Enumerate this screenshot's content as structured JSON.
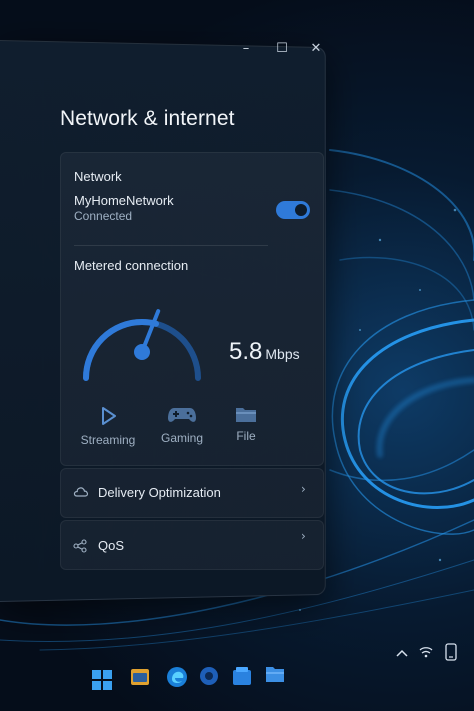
{
  "window": {
    "title": "Network & internet",
    "controls": {
      "minimize": "–",
      "maximize": "☐",
      "close": "✕"
    }
  },
  "network": {
    "heading": "Network",
    "name": "MyHomeNetwork",
    "status": "Connected",
    "toggle_on": true
  },
  "metered": {
    "label": "Metered connection",
    "speed_value": "5.8",
    "speed_unit": "Mbps",
    "gauge_level": 0.58
  },
  "usage": [
    {
      "label": "Streaming",
      "icon": "play-icon"
    },
    {
      "label": "Gaming",
      "icon": "gamepad-icon"
    },
    {
      "label": "File",
      "icon": "folder-icon"
    }
  ],
  "rows": {
    "delivery": {
      "label": "Delivery Optimization",
      "icon": "cloud-icon",
      "chevron": "›"
    },
    "qos": {
      "label": "QoS",
      "icon": "share-icon",
      "chevron": "›"
    }
  },
  "taskbar": {
    "icons": [
      "windows-start-icon",
      "explorer-icon",
      "edge-icon",
      "app-icon",
      "store-icon",
      "folder-icon"
    ],
    "tray": [
      "chevron-up-icon",
      "wifi-icon",
      "phone-icon"
    ]
  },
  "colors": {
    "accent": "#2f7ad9",
    "window_bg": "#0e1b2a",
    "wallpaper_glow": "#1b8fe0"
  }
}
